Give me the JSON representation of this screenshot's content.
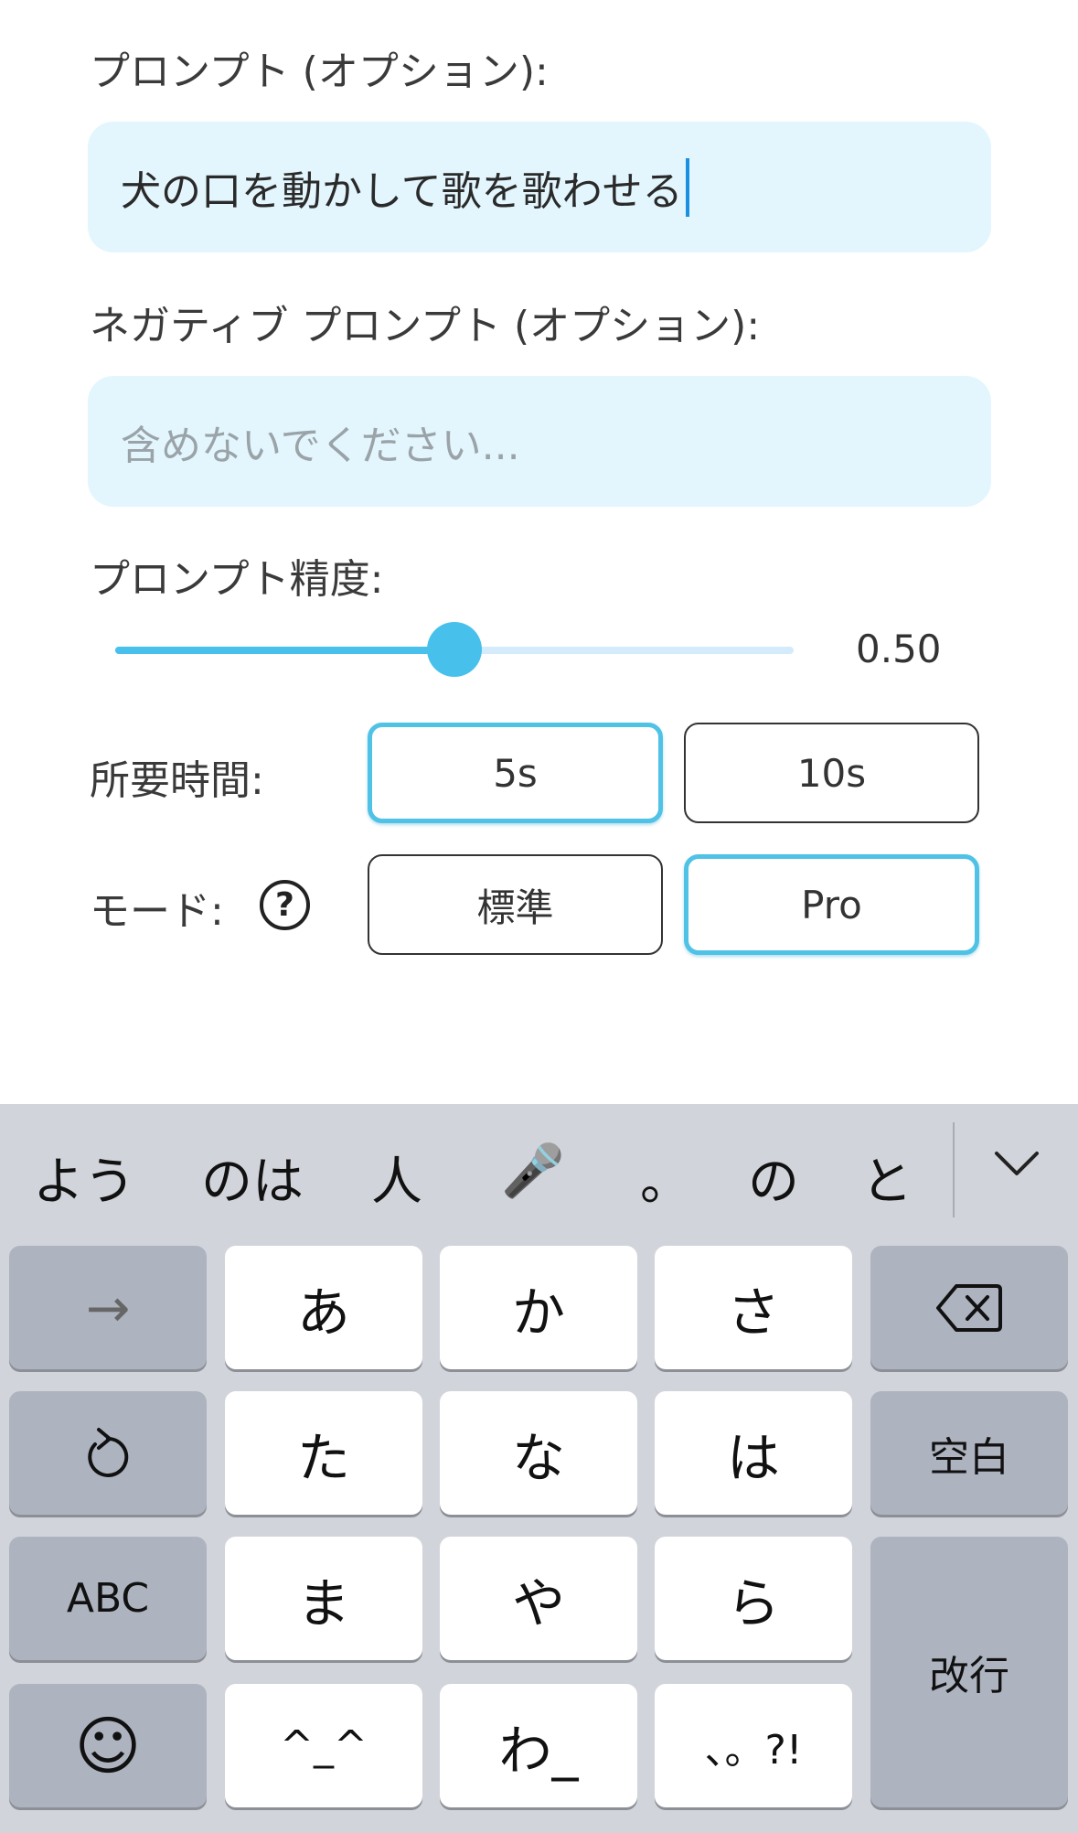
{
  "form": {
    "prompt_label": "プロンプト (オプション):",
    "prompt_value": "犬の口を動かして歌を歌わせる",
    "negative_label": "ネガティブ プロンプト (オプション):",
    "negative_placeholder": "含めないでください...",
    "accuracy_label": "プロンプト精度:",
    "accuracy_value": 0.5,
    "accuracy_display": "0.50",
    "duration_label": "所要時間:",
    "duration_options": [
      "5s",
      "10s"
    ],
    "duration_selected": "5s",
    "mode_label": "モード:",
    "mode_help": "?",
    "mode_options": [
      "標準",
      "Pro"
    ],
    "mode_selected": "Pro"
  },
  "colors": {
    "accent": "#48c0ec",
    "field_bg": "#e3f6fd",
    "caret": "#1b8fe0",
    "keyboard_bg": "#d1d4da"
  },
  "keyboard": {
    "suggestions": [
      "よう",
      "のは",
      "人",
      "🎤",
      "。",
      "の",
      "と"
    ],
    "collapse_icon": "chevron-down-icon",
    "keys": {
      "next": "→",
      "a": "あ",
      "ka": "か",
      "sa": "さ",
      "backspace_icon": "backspace-icon",
      "undo_icon": "undo-icon",
      "ta": "た",
      "na": "な",
      "ha": "は",
      "space": "空白",
      "abc": "ABC",
      "ma": "ま",
      "ya": "や",
      "ra": "ら",
      "enter": "改行",
      "emoji": "☺",
      "kaomoji": "^_^",
      "wa": "わ_",
      "punct": "、。?!"
    }
  }
}
